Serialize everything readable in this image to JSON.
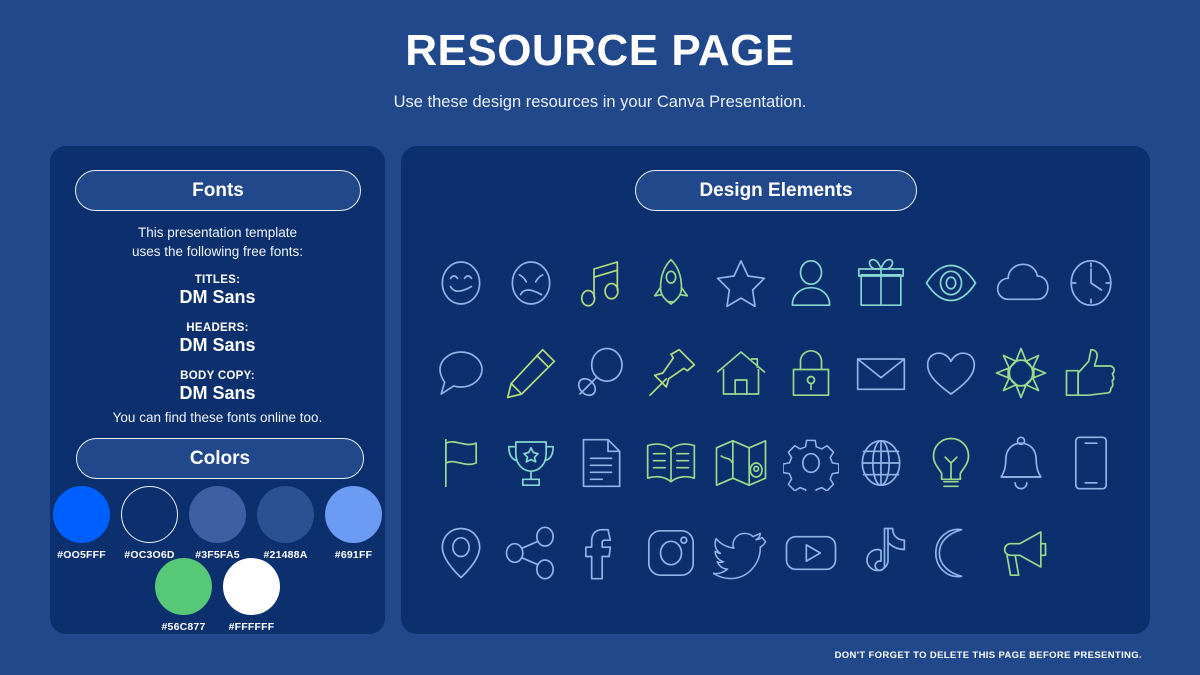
{
  "header": {
    "title": "RESOURCE PAGE",
    "subtitle": "Use these design resources in your Canva Presentation."
  },
  "fonts_panel": {
    "heading": "Fonts",
    "intro": "This presentation template\nuses the following free fonts:",
    "groups": [
      {
        "label": "TITLES:",
        "value": "DM Sans"
      },
      {
        "label": "HEADERS:",
        "value": "DM Sans"
      },
      {
        "label": "BODY COPY:",
        "value": "DM Sans"
      }
    ],
    "outro": "You can find these fonts online too."
  },
  "colors_panel": {
    "heading": "Colors",
    "row1": [
      {
        "hex": "#OO5FFF",
        "color": "#005FFF",
        "outlined": false
      },
      {
        "hex": "#OC3O6D",
        "color": "#0C306D",
        "outlined": true
      },
      {
        "hex": "#3F5FA5",
        "color": "#3F5FA5",
        "outlined": false
      },
      {
        "hex": "#21488A",
        "color": "#2B5192",
        "outlined": false
      },
      {
        "hex": "#691FF",
        "color": "#6C9BF4",
        "outlined": false
      }
    ],
    "row2": [
      {
        "hex": "#56C877",
        "color": "#56C877",
        "outlined": false
      },
      {
        "hex": "#FFFFFF",
        "color": "#FFFFFF",
        "outlined": false
      }
    ]
  },
  "design_panel": {
    "heading": "Design Elements",
    "icons": [
      "smiley-face-icon",
      "sad-face-icon",
      "music-note-icon",
      "rocket-icon",
      "star-icon",
      "person-icon",
      "gift-icon",
      "eye-icon",
      "cloud-icon",
      "clock-icon",
      "speech-bubble-icon",
      "pencil-icon",
      "magnifier-icon",
      "pushpin-icon",
      "house-icon",
      "lock-icon",
      "envelope-icon",
      "heart-icon",
      "sun-icon",
      "thumbs-up-icon",
      "flag-icon",
      "trophy-icon",
      "document-icon",
      "book-icon",
      "map-icon",
      "gear-icon",
      "globe-icon",
      "lightbulb-icon",
      "bell-icon",
      "phone-icon",
      "location-pin-icon",
      "share-icon",
      "facebook-icon",
      "instagram-icon",
      "twitter-icon",
      "youtube-icon",
      "tiktok-icon",
      "moon-icon",
      "megaphone-icon"
    ]
  },
  "footer": {
    "note": "DON'T FORGET TO DELETE THIS PAGE BEFORE PRESENTING."
  },
  "theme": {
    "background": "#21488A",
    "panel": "#0C306D",
    "pill": "#21488A",
    "text": "#FFFFFF"
  }
}
